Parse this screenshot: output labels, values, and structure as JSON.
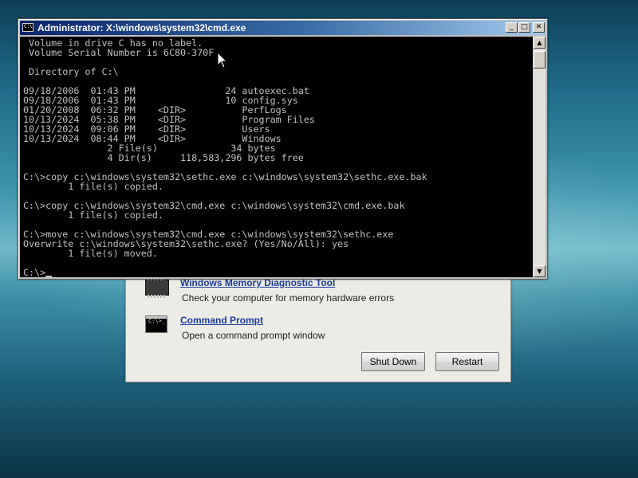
{
  "console": {
    "title": "Administrator: X:\\windows\\system32\\cmd.exe",
    "icon_label": "C:\\",
    "buttons": {
      "minimize": "_",
      "maximize": "□",
      "close": "✕"
    },
    "lines": [
      " Volume in drive C has no label.",
      " Volume Serial Number is 6C80-370F",
      "",
      " Directory of C:\\",
      "",
      "09/18/2006  01:43 PM                24 autoexec.bat",
      "09/18/2006  01:43 PM                10 config.sys",
      "01/20/2008  06:32 PM    <DIR>          PerfLogs",
      "10/13/2024  05:38 PM    <DIR>          Program Files",
      "10/13/2024  09:06 PM    <DIR>          Users",
      "10/13/2024  08:44 PM    <DIR>          Windows",
      "               2 File(s)             34 bytes",
      "               4 Dir(s)     118,583,296 bytes free",
      "",
      "C:\\>copy c:\\windows\\system32\\sethc.exe c:\\windows\\system32\\sethc.exe.bak",
      "        1 file(s) copied.",
      "",
      "C:\\>copy c:\\windows\\system32\\cmd.exe c:\\windows\\system32\\cmd.exe.bak",
      "        1 file(s) copied.",
      "",
      "C:\\>move c:\\windows\\system32\\cmd.exe c:\\windows\\system32\\sethc.exe",
      "Overwrite c:\\windows\\system32\\sethc.exe? (Yes/No/All): yes",
      "        1 file(s) moved.",
      "",
      "C:\\>"
    ],
    "scroll": {
      "up": "▲",
      "down": "▼"
    }
  },
  "recovery": {
    "memory_tool": {
      "link": "Windows Memory Diagnostic Tool",
      "description": "Check your computer for memory hardware errors",
      "icon": "memory-chip-icon"
    },
    "command_prompt": {
      "link": "Command Prompt",
      "description": "Open a command prompt window",
      "icon": "command-prompt-icon",
      "icon_text": "C:\\>_"
    },
    "shutdown_label": "Shut Down",
    "restart_label": "Restart"
  },
  "colors": {
    "terminal_bg": "#000000",
    "terminal_fg": "#c0c0c0",
    "titlebar_start": "#0a246a",
    "titlebar_end": "#a6caf0",
    "link": "#1a3c9a"
  }
}
